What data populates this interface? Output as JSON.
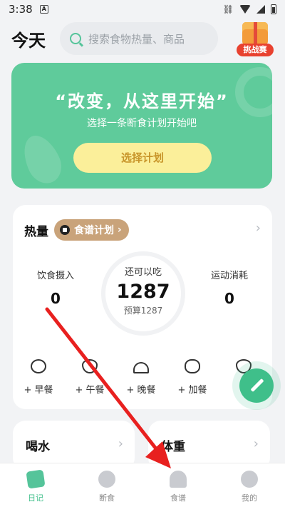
{
  "status_bar": {
    "time": "3:38",
    "notification": "A",
    "link_icon": "link-icon"
  },
  "header": {
    "title": "今天",
    "search_placeholder": "搜索食物热量、商品",
    "challenge_label": "挑战赛"
  },
  "banner": {
    "quote": "“改变，从这里开始”",
    "subtitle": "选择一条断食计划开始吧",
    "button": "选择计划"
  },
  "calories": {
    "title": "热量",
    "plan_chip": "食谱计划",
    "intake_label": "饮食摄入",
    "intake_value": "0",
    "remaining_label": "还可以吃",
    "remaining_value": "1287",
    "budget_text": "预算1287",
    "burned_label": "运动消耗",
    "burned_value": "0",
    "meals": [
      {
        "label": "+ 早餐",
        "icon": "eye-bowl-icon"
      },
      {
        "label": "+ 午餐",
        "icon": "bowl-icon"
      },
      {
        "label": "+ 晚餐",
        "icon": "cloche-icon"
      },
      {
        "label": "+ 加餐",
        "icon": "apple-icon"
      },
      {
        "label": "+",
        "icon": "snack-icon"
      }
    ]
  },
  "cards": {
    "water": "喝水",
    "weight": "体重"
  },
  "tabs": [
    {
      "label": "日记",
      "icon": "diary-icon",
      "active": true
    },
    {
      "label": "断食",
      "icon": "fasting-icon",
      "active": false
    },
    {
      "label": "食谱",
      "icon": "recipe-icon",
      "active": false
    },
    {
      "label": "我的",
      "icon": "profile-icon",
      "active": false
    }
  ],
  "colors": {
    "accent": "#3fbf8a",
    "banner": "#5fcb9b",
    "cta": "#fbef9a",
    "chip": "#c9a37a",
    "arrow": "#e8201f"
  }
}
